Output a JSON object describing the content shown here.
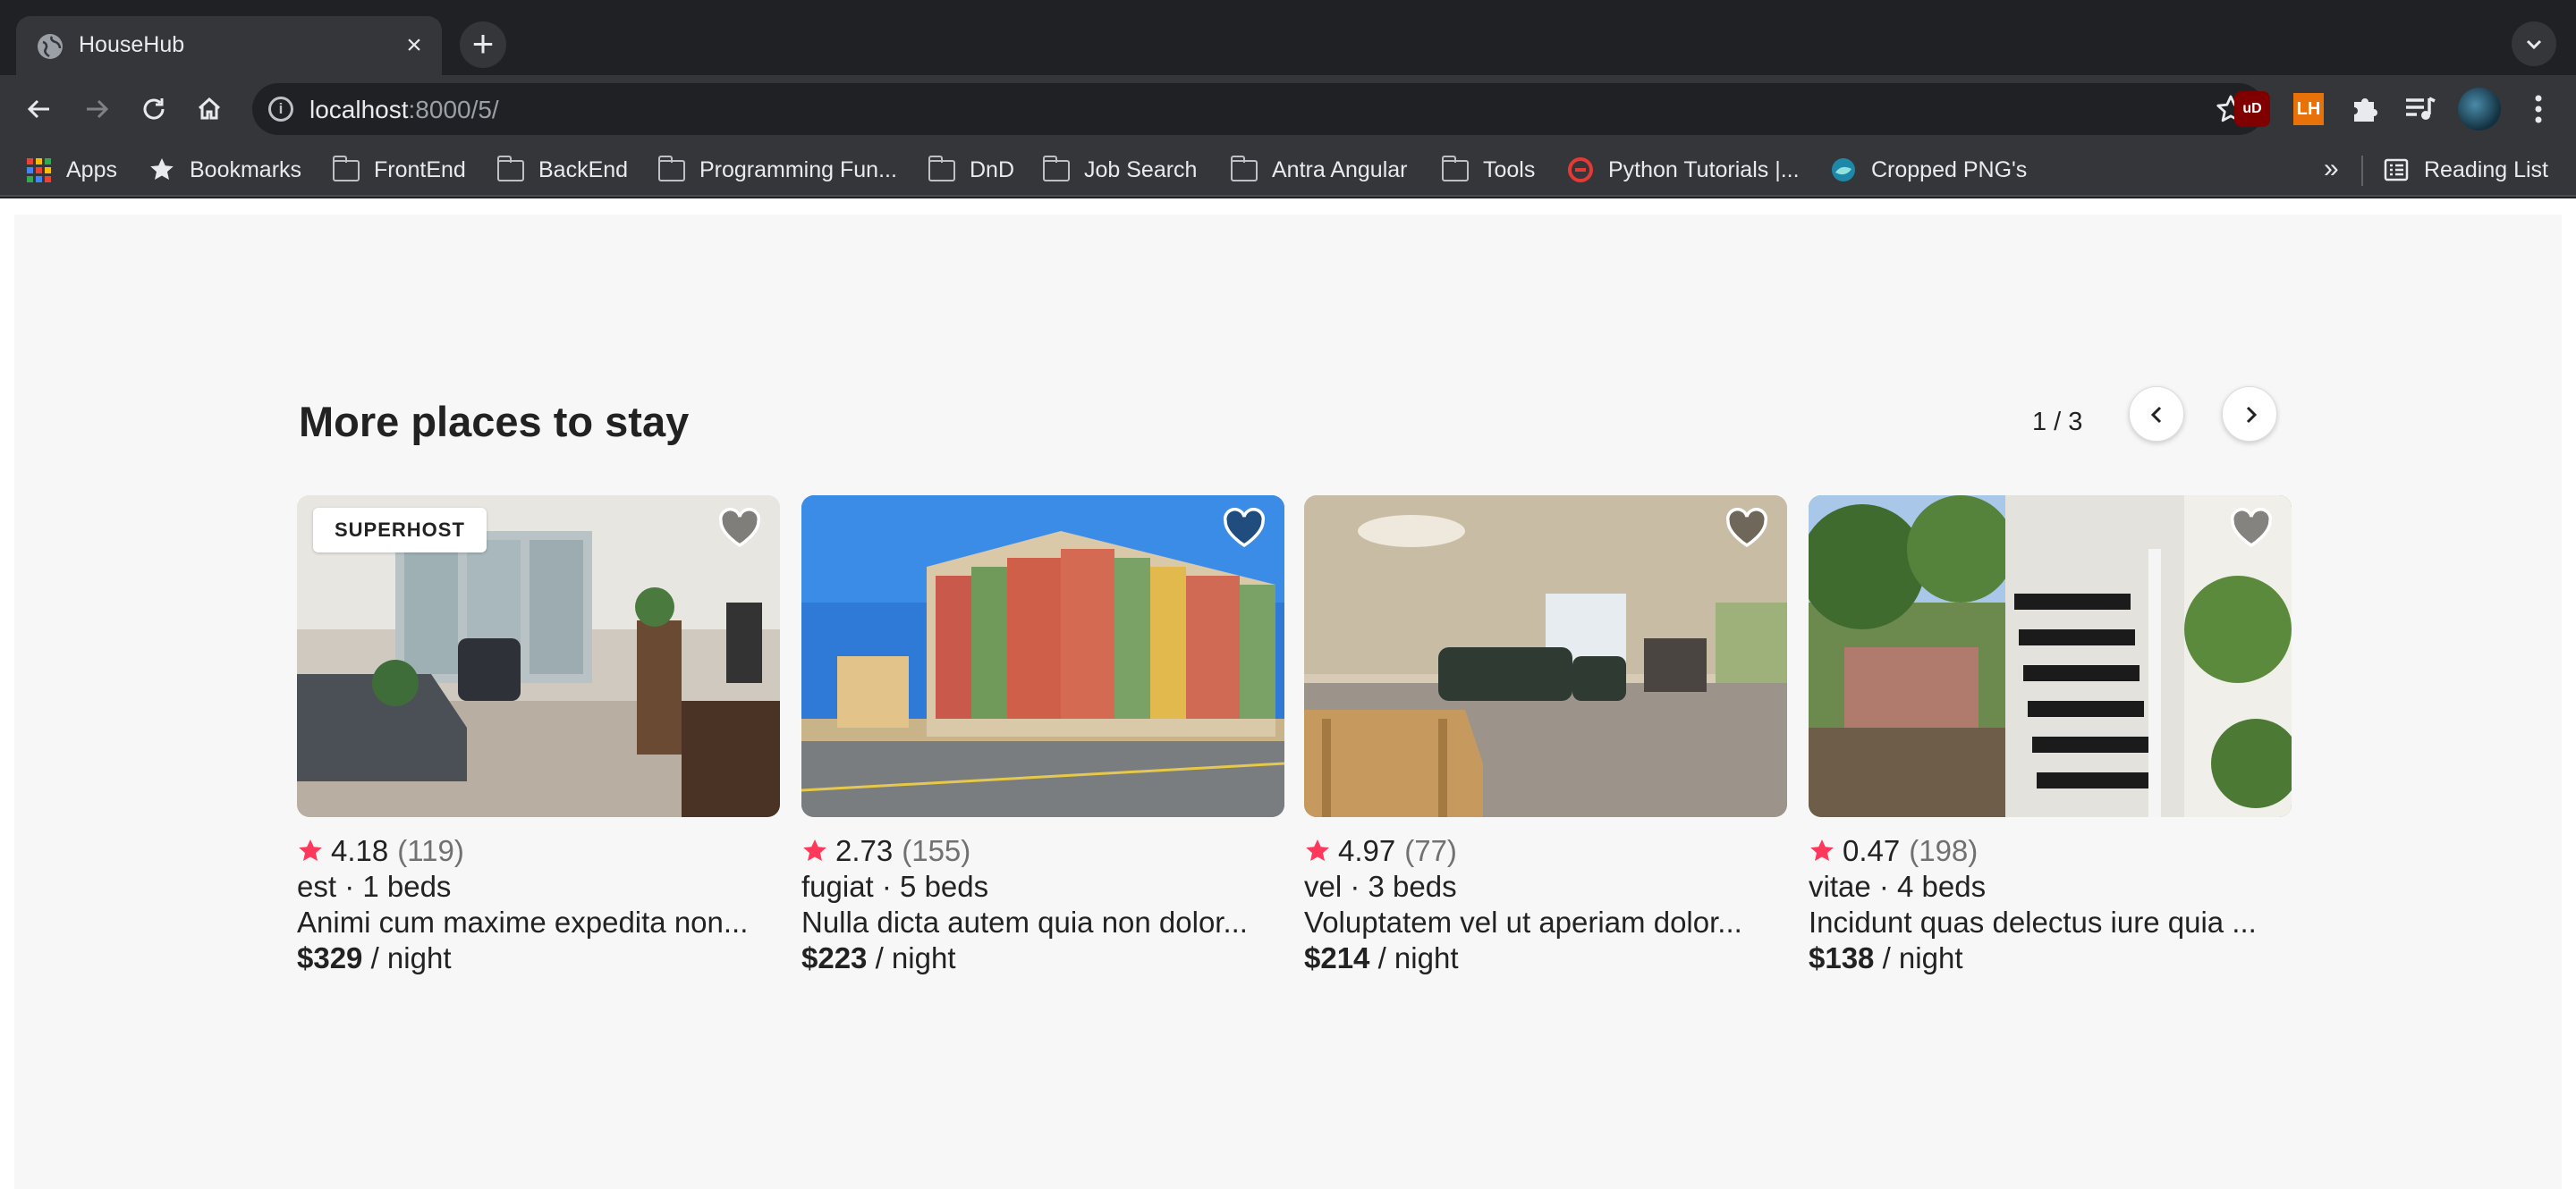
{
  "browser": {
    "tab_title": "HouseHub",
    "url_host": "localhost",
    "url_rest": ":8000/5/",
    "bookmarks": [
      {
        "label": "Apps",
        "icon": "apps-grid-icon"
      },
      {
        "label": "Bookmarks",
        "icon": "star-icon"
      },
      {
        "label": "FrontEnd",
        "icon": "folder-icon"
      },
      {
        "label": "BackEnd",
        "icon": "folder-icon"
      },
      {
        "label": "Programming Fun...",
        "icon": "folder-icon"
      },
      {
        "label": "DnD",
        "icon": "folder-icon"
      },
      {
        "label": "Job Search",
        "icon": "folder-icon"
      },
      {
        "label": "Antra Angular",
        "icon": "folder-icon"
      },
      {
        "label": "Tools",
        "icon": "folder-icon"
      },
      {
        "label": "Python Tutorials |...",
        "icon": "python-tutorials-favicon"
      },
      {
        "label": "Cropped PNG's",
        "icon": "cropped-png-favicon"
      }
    ],
    "more_label": "»",
    "reading_list_label": "Reading List",
    "extensions": {
      "ublock": "uD",
      "lighthouse": "LH"
    }
  },
  "section": {
    "title": "More places to stay",
    "page_indicator": "1 / 3"
  },
  "listings": [
    {
      "badge": "SUPERHOST",
      "rating": "4.18",
      "reviews": "(119)",
      "type_beds": "est · 1 beds",
      "description": "Animi cum maxime expedita non...",
      "price": "$329",
      "per": " / night",
      "photo": "living-room-photo"
    },
    {
      "badge": "",
      "rating": "2.73",
      "reviews": "(155)",
      "type_beds": "fugiat · 5 beds",
      "description": "Nulla dicta autem quia non dolor...",
      "price": "$223",
      "per": " / night",
      "photo": "apartment-building-photo"
    },
    {
      "badge": "",
      "rating": "4.97",
      "reviews": "(77)",
      "type_beds": "vel · 3 beds",
      "description": "Voluptatem vel ut aperiam dolor...",
      "price": "$214",
      "per": " / night",
      "photo": "empty-living-room-photo"
    },
    {
      "badge": "",
      "rating": "0.47",
      "reviews": "(198)",
      "type_beds": "vitae · 4 beds",
      "description": "Incidunt quas delectus iure quia ...",
      "price": "$138",
      "per": " / night",
      "photo": "garden-staircase-photo"
    }
  ],
  "colors": {
    "accent_star": "#ff385c",
    "text": "#222222",
    "muted": "#717171",
    "page_bg": "#f7f7f7"
  }
}
